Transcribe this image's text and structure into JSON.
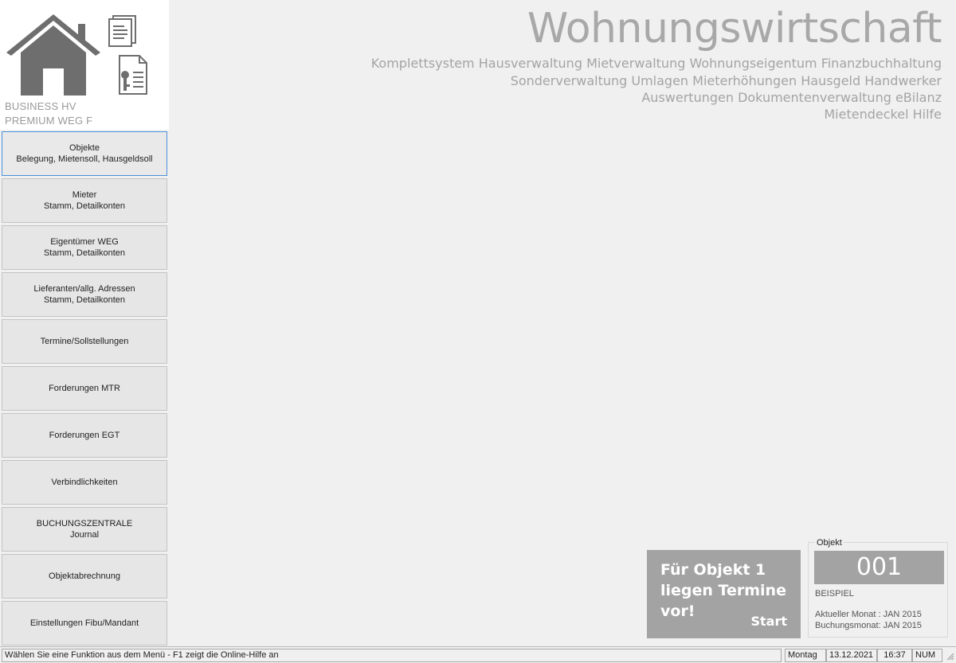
{
  "branding": {
    "edition_line1": "BUSINESS HV",
    "edition_line2": "PREMIUM WEG F"
  },
  "nav": [
    {
      "line1": "Objekte",
      "line2": "Belegung, Mietensoll, Hausgeldsoll"
    },
    {
      "line1": "Mieter",
      "line2": "Stamm, Detailkonten"
    },
    {
      "line1": "Eigentümer WEG",
      "line2": "Stamm, Detailkonten"
    },
    {
      "line1": "Lieferanten/allg. Adressen",
      "line2": "Stamm, Detailkonten"
    },
    {
      "line1": "Termine/Sollstellungen",
      "line2": ""
    },
    {
      "line1": "Forderungen MTR",
      "line2": ""
    },
    {
      "line1": "Forderungen EGT",
      "line2": ""
    },
    {
      "line1": "Verbindlichkeiten",
      "line2": ""
    },
    {
      "line1": "BUCHUNGSZENTRALE",
      "line2": "Journal"
    },
    {
      "line1": "Objektabrechnung",
      "line2": ""
    },
    {
      "line1": "Einstellungen Fibu/Mandant",
      "line2": ""
    }
  ],
  "header": {
    "title": "Wohnungswirtschaft",
    "lines": [
      "Komplettsystem Hausverwaltung Mietverwaltung Wohnungseigentum Finanzbuchhaltung",
      "Sonderverwaltung Umlagen Mieterhöhungen Hausgeld Handwerker",
      "Auswertungen Dokumentenverwaltung eBilanz",
      "Mietendeckel Hilfe"
    ]
  },
  "termine": {
    "message": "Für Objekt 1 liegen Termine vor!",
    "start_label": "Start"
  },
  "objekt": {
    "group_label": "Objekt",
    "number": "001",
    "name": "BEISPIEL",
    "current_month": "Aktueller Monat : JAN 2015",
    "booking_month": "Buchungsmonat: JAN 2015"
  },
  "statusbar": {
    "message": "Wählen Sie eine Funktion aus dem Menü - F1 zeigt die Online-Hilfe an",
    "day": "Montag",
    "date": "13.12.2021",
    "time": "16:37",
    "num": "NUM"
  },
  "colors": {
    "background": "#f0f0f0",
    "accent_gray": "#a3a3a3",
    "active_border": "#4a90d9"
  }
}
